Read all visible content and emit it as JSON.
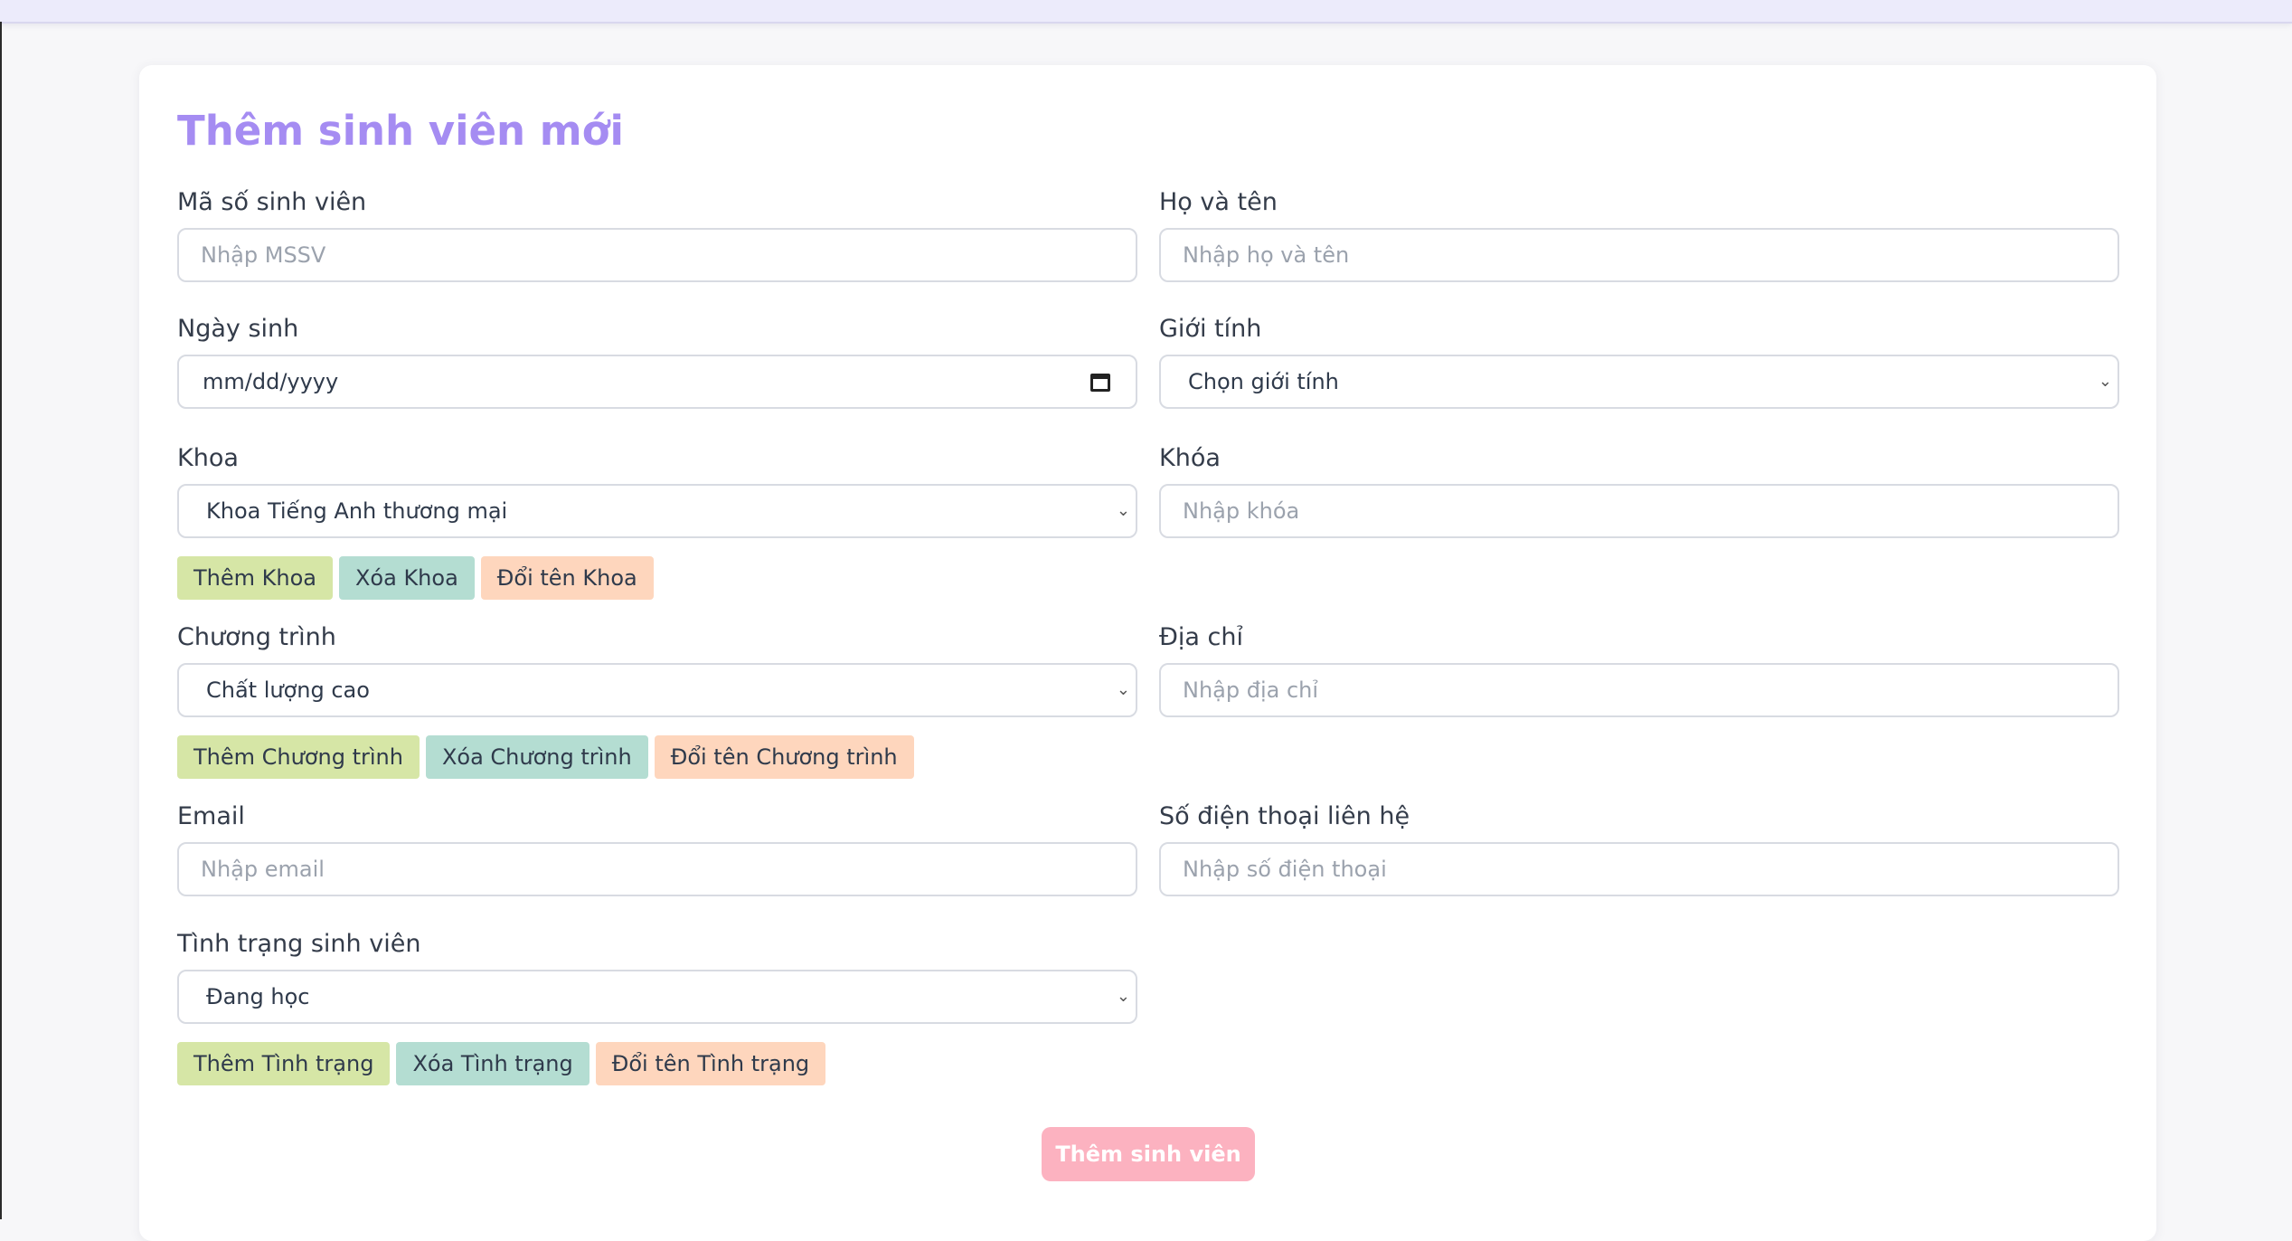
{
  "form": {
    "title": "Thêm sinh viên mới",
    "mssv": {
      "label": "Mã số sinh viên",
      "placeholder": "Nhập MSSV"
    },
    "fullname": {
      "label": "Họ và tên",
      "placeholder": "Nhập họ và tên"
    },
    "dob": {
      "label": "Ngày sinh",
      "value": "mm/dd/yyyy",
      "icon": "calendar-icon"
    },
    "gender": {
      "label": "Giới tính",
      "value": "Chọn giới tính",
      "icon": "chevron-down-icon"
    },
    "faculty": {
      "label": "Khoa",
      "value": "Khoa Tiếng Anh thương mại",
      "add": "Thêm Khoa",
      "delete": "Xóa Khoa",
      "rename": "Đổi tên Khoa"
    },
    "course": {
      "label": "Khóa",
      "placeholder": "Nhập khóa"
    },
    "program": {
      "label": "Chương trình",
      "value": "Chất lượng cao",
      "add": "Thêm Chương trình",
      "delete": "Xóa Chương trình",
      "rename": "Đổi tên Chương trình"
    },
    "address": {
      "label": "Địa chỉ",
      "placeholder": "Nhập địa chỉ"
    },
    "email": {
      "label": "Email",
      "placeholder": "Nhập email"
    },
    "phone": {
      "label": "Số điện thoại liên hệ",
      "placeholder": "Nhập số điện thoại"
    },
    "status": {
      "label": "Tình trạng sinh viên",
      "value": "Đang học",
      "add": "Thêm Tình trạng",
      "delete": "Xóa Tình trạng",
      "rename": "Đổi tên Tình trạng"
    },
    "submit_label": "Thêm sinh viên"
  },
  "colors": {
    "title": "#a58cf2",
    "add_button": "#d6e6a6",
    "delete_button": "#b4ddd2",
    "rename_button": "#fed6bd",
    "submit_button": "#fcb2c0"
  }
}
